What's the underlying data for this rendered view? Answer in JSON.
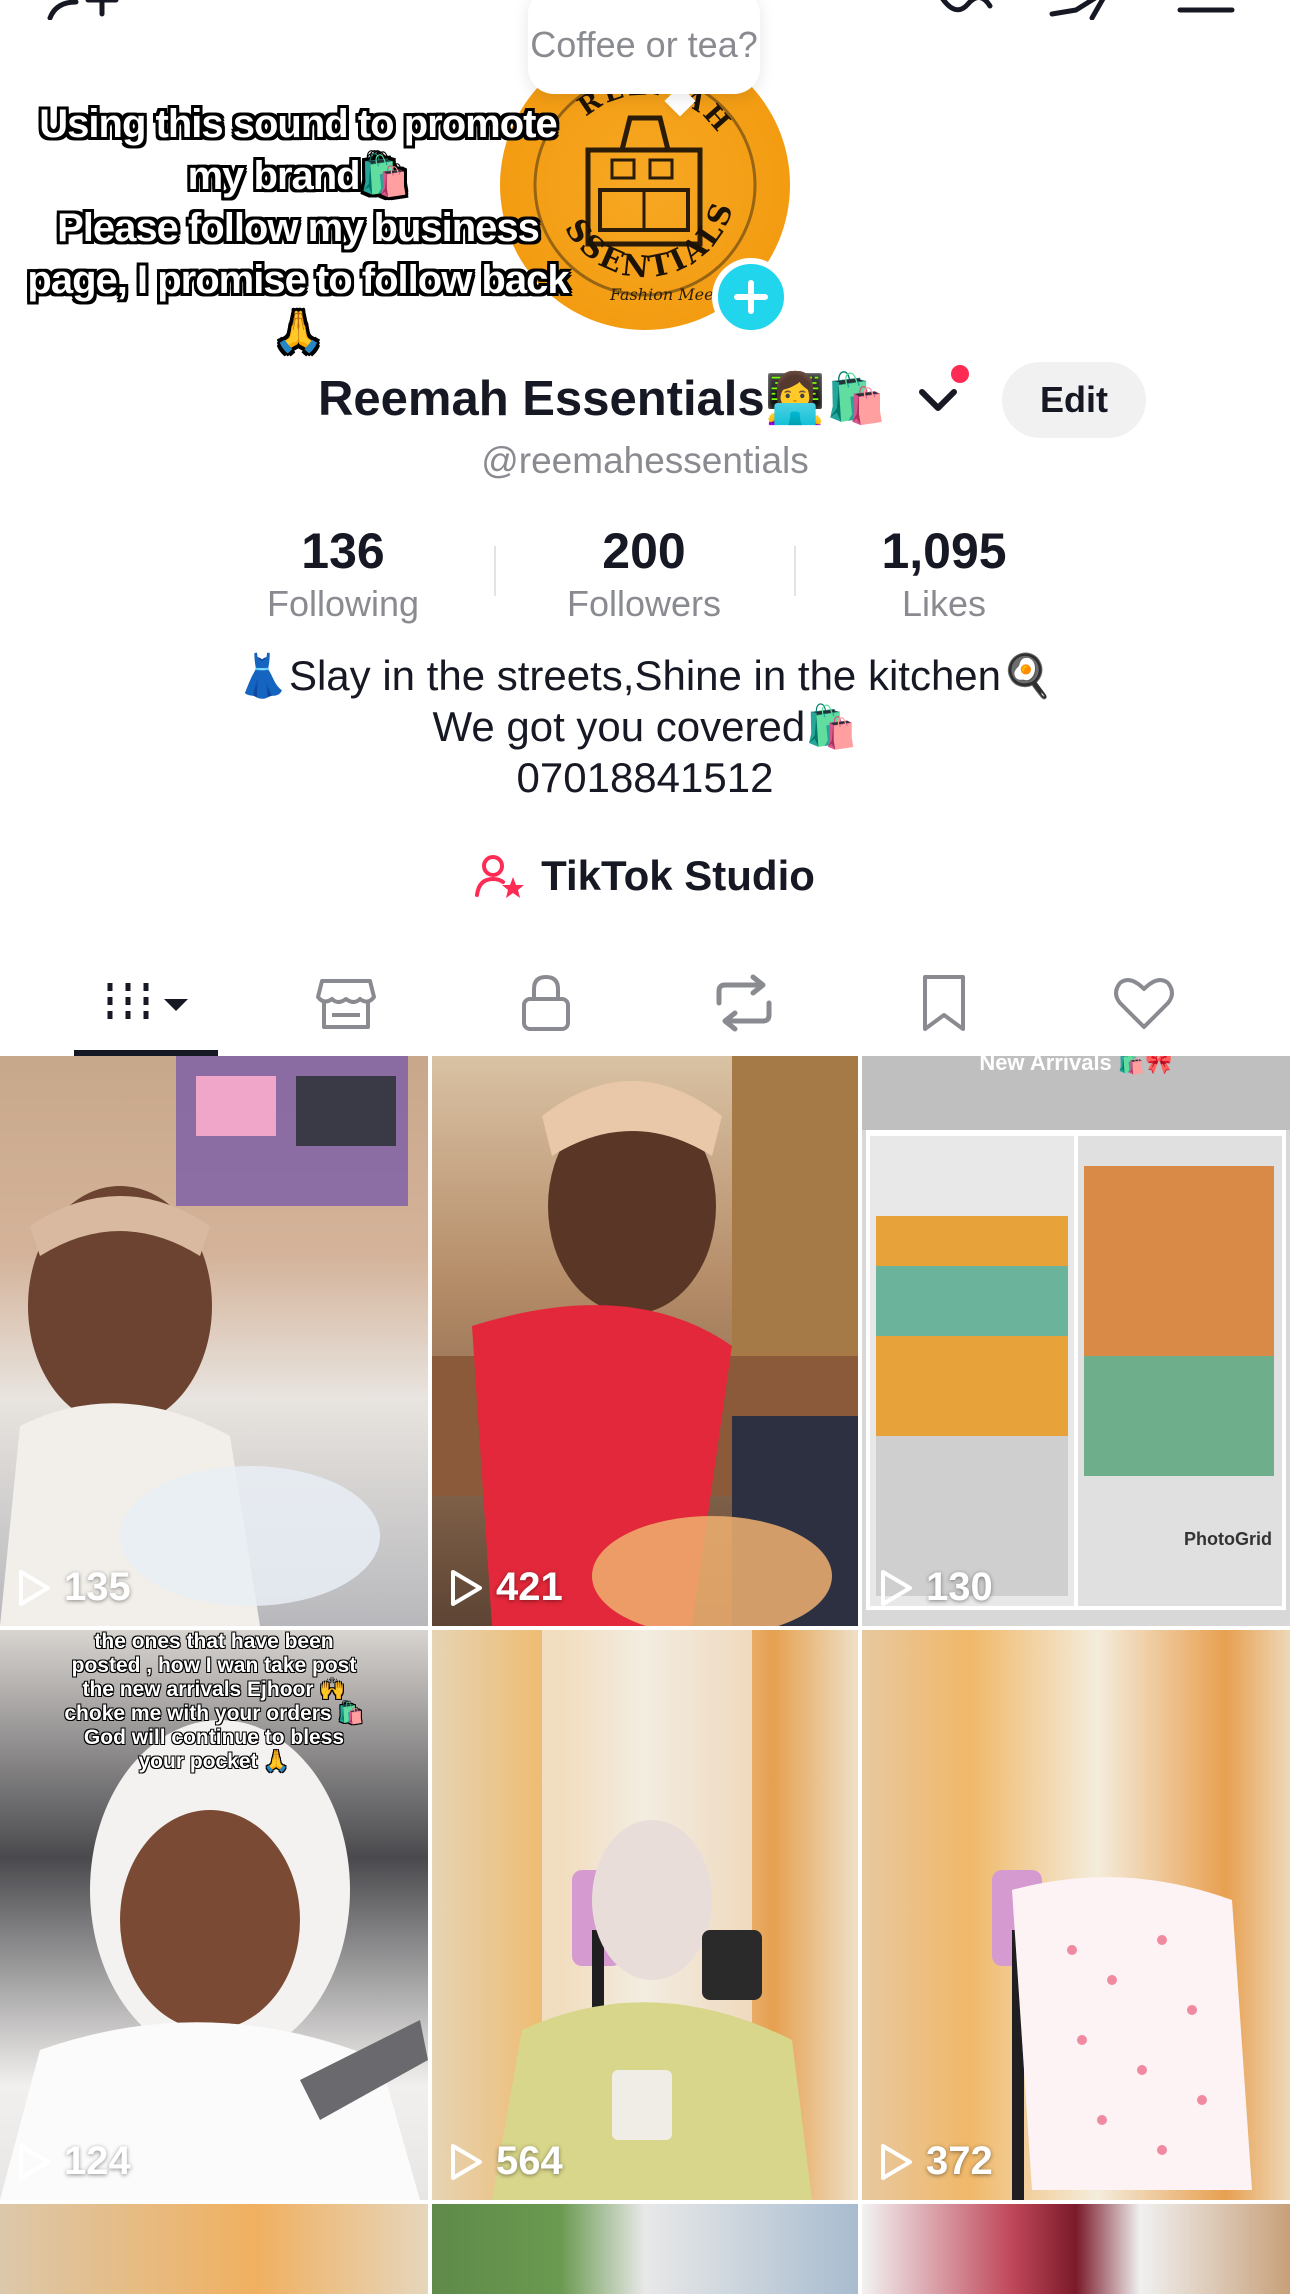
{
  "tooltip": {
    "text": "Coffee or tea?"
  },
  "overlay_caption": "Using this sound to promote my brand🛍️\nPlease follow my business page, I promise to follow back🙏",
  "avatar": {
    "brand_text": "REEMAH ESSENTIALS",
    "tagline": "Fashion Meets Home"
  },
  "profile": {
    "name": "Reemah Essentials👩‍💻🛍️",
    "username": "@reemahessentials",
    "edit_label": "Edit"
  },
  "stats": [
    {
      "value": "136",
      "label": "Following"
    },
    {
      "value": "200",
      "label": "Followers"
    },
    {
      "value": "1,095",
      "label": "Likes"
    }
  ],
  "bio": {
    "line1": "👗Slay in the streets,Shine in the kitchen🍳",
    "line2": "We got you covered🛍️",
    "line3": "07018841512"
  },
  "studio": {
    "label": "TikTok Studio"
  },
  "tabs": [
    {
      "icon": "videos-grid-icon",
      "selected": true
    },
    {
      "icon": "shop-icon"
    },
    {
      "icon": "lock-icon"
    },
    {
      "icon": "repost-icon"
    },
    {
      "icon": "bookmark-icon"
    },
    {
      "icon": "heart-icon"
    }
  ],
  "videos": [
    {
      "views": "135"
    },
    {
      "views": "421"
    },
    {
      "views": "130",
      "header": "New Arrivals 🛍️🎀",
      "photo_tag": "PhotoGrid"
    },
    {
      "views": "124",
      "caption": "the ones that have been\nposted , how I wan take post\nthe new arrivals Ejhoor 🙌\nchoke me with your orders 🛍️\nGod will continue to bless\nyour pocket 🙏"
    },
    {
      "views": "564"
    },
    {
      "views": "372"
    }
  ],
  "colors": {
    "accent_red": "#fe2c55",
    "plus_cyan": "#20d5ec",
    "avatar_orange": "#f39c12"
  }
}
